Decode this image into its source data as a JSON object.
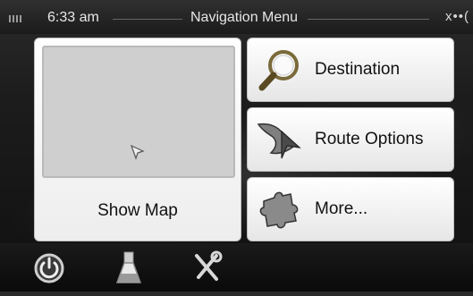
{
  "status_bar": {
    "time": "6:33 am",
    "title": "Navigation Menu",
    "battery_icon": "battery-icon",
    "indicator_icons": "satellite-gps-icons",
    "indicator_text": "х••("
  },
  "menu": {
    "show_map": {
      "label": "Show Map",
      "preview_icon": "cursor-arrow-icon"
    },
    "destination": {
      "label": "Destination",
      "icon": "magnifier-icon"
    },
    "route_options": {
      "label": "Route Options",
      "icon": "route-arrow-icon"
    },
    "more": {
      "label": "More...",
      "icon": "puzzle-piece-icon"
    }
  },
  "bottom_bar": {
    "icons": [
      "power-icon",
      "flask-icon",
      "tools-icon"
    ]
  },
  "colors": {
    "button_bg": "#f4f4f4",
    "map_preview_bg": "#cfcfcf",
    "status_bar_bg": "#242424"
  }
}
